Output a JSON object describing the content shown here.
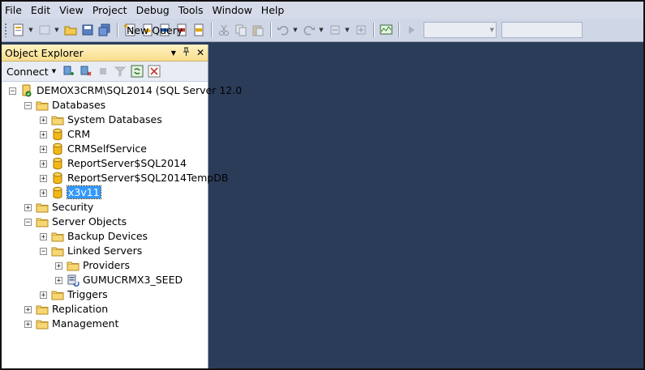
{
  "menu": [
    "File",
    "Edit",
    "View",
    "Project",
    "Debug",
    "Tools",
    "Window",
    "Help"
  ],
  "toolbar": {
    "new_query_label": "New Query"
  },
  "object_explorer": {
    "title": "Object Explorer",
    "pin": "−1",
    "connect_label": "Connect",
    "tree": [
      {
        "label": "DEMOX3CRM\\SQL2014 (SQL Server 12.0",
        "icon": "server-icon",
        "expander": "−"
      },
      {
        "label": "Databases",
        "icon": "folder-icon",
        "expander": "−"
      },
      {
        "label": "System Databases",
        "icon": "folder-icon",
        "expander": "+"
      },
      {
        "label": "CRM",
        "icon": "database-icon",
        "expander": "+"
      },
      {
        "label": "CRMSelfService",
        "icon": "database-icon",
        "expander": "+"
      },
      {
        "label": "ReportServer$SQL2014",
        "icon": "database-icon",
        "expander": "+"
      },
      {
        "label": "ReportServer$SQL2014TempDB",
        "icon": "database-icon",
        "expander": "+"
      },
      {
        "label": "x3v11",
        "icon": "database-icon",
        "expander": "+",
        "selected": true
      },
      {
        "label": "Security",
        "icon": "folder-icon",
        "expander": "+"
      },
      {
        "label": "Server Objects",
        "icon": "folder-icon",
        "expander": "−"
      },
      {
        "label": "Backup Devices",
        "icon": "folder-icon",
        "expander": "+"
      },
      {
        "label": "Linked Servers",
        "icon": "folder-icon",
        "expander": "−"
      },
      {
        "label": "Providers",
        "icon": "folder-icon",
        "expander": "+"
      },
      {
        "label": "GUMUCRMX3_SEED",
        "icon": "linked-server-icon",
        "expander": "+"
      },
      {
        "label": "Triggers",
        "icon": "folder-icon",
        "expander": "+"
      },
      {
        "label": "Replication",
        "icon": "folder-icon",
        "expander": "+"
      },
      {
        "label": "Management",
        "icon": "folder-icon",
        "expander": "+"
      }
    ]
  },
  "colors": {
    "workspace": "#2b3c59",
    "selection": "#3399ff",
    "panel_title": "#f9dd8c"
  }
}
